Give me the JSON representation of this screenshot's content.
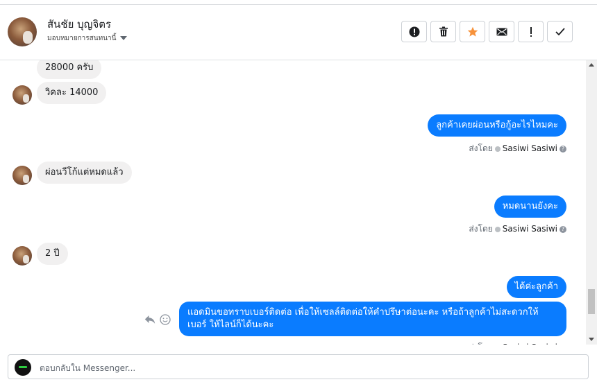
{
  "header": {
    "contact_name": "สันชัย บุญจิตร",
    "assign_label": "มอบหมายการสนทนานี้"
  },
  "actions": [
    {
      "name": "spam-icon",
      "symbol": "!"
    },
    {
      "name": "trash-icon",
      "symbol": ""
    },
    {
      "name": "star-icon",
      "symbol": ""
    },
    {
      "name": "mail-icon",
      "symbol": ""
    },
    {
      "name": "follow-up-icon",
      "symbol": "!"
    },
    {
      "name": "done-icon",
      "symbol": ""
    }
  ],
  "messages": [
    {
      "dir": "in",
      "text": "28000 ครับ"
    },
    {
      "dir": "in",
      "text": "วิคละ 14000"
    },
    {
      "dir": "out",
      "text": "ลูกค้าเคยผ่อนหรือกู้อะไรไหมคะ"
    },
    {
      "dir": "in",
      "text": "ผ่อนวีโก้แต่หมดแล้ว"
    },
    {
      "dir": "out",
      "text": "หมดนานยังคะ"
    },
    {
      "dir": "in",
      "text": "2 ปี"
    },
    {
      "dir": "out",
      "text": "ได้ค่ะลูกค้า"
    },
    {
      "dir": "out",
      "text_line1": "แอดมินขอทราบเบอร์ติดต่อ เพื่อให้เซลล์ติดต่อให้คำปรึษาต่อนะคะ หรือถ้าลูกค้าไม่สะดวกให้",
      "text_line2": "เบอร์ ให้ไลน์ก็ได้นะคะ"
    }
  ],
  "sent_by": {
    "prefix": "ส่งโดย",
    "agent": "Sasiwi Sasiwi"
  },
  "reply": {
    "placeholder": "ตอบกลับใน Messenger..."
  },
  "colors": {
    "outgoing_bubble": "#0a7cff",
    "incoming_bubble": "#f1f0f0",
    "star": "#f7923a"
  }
}
